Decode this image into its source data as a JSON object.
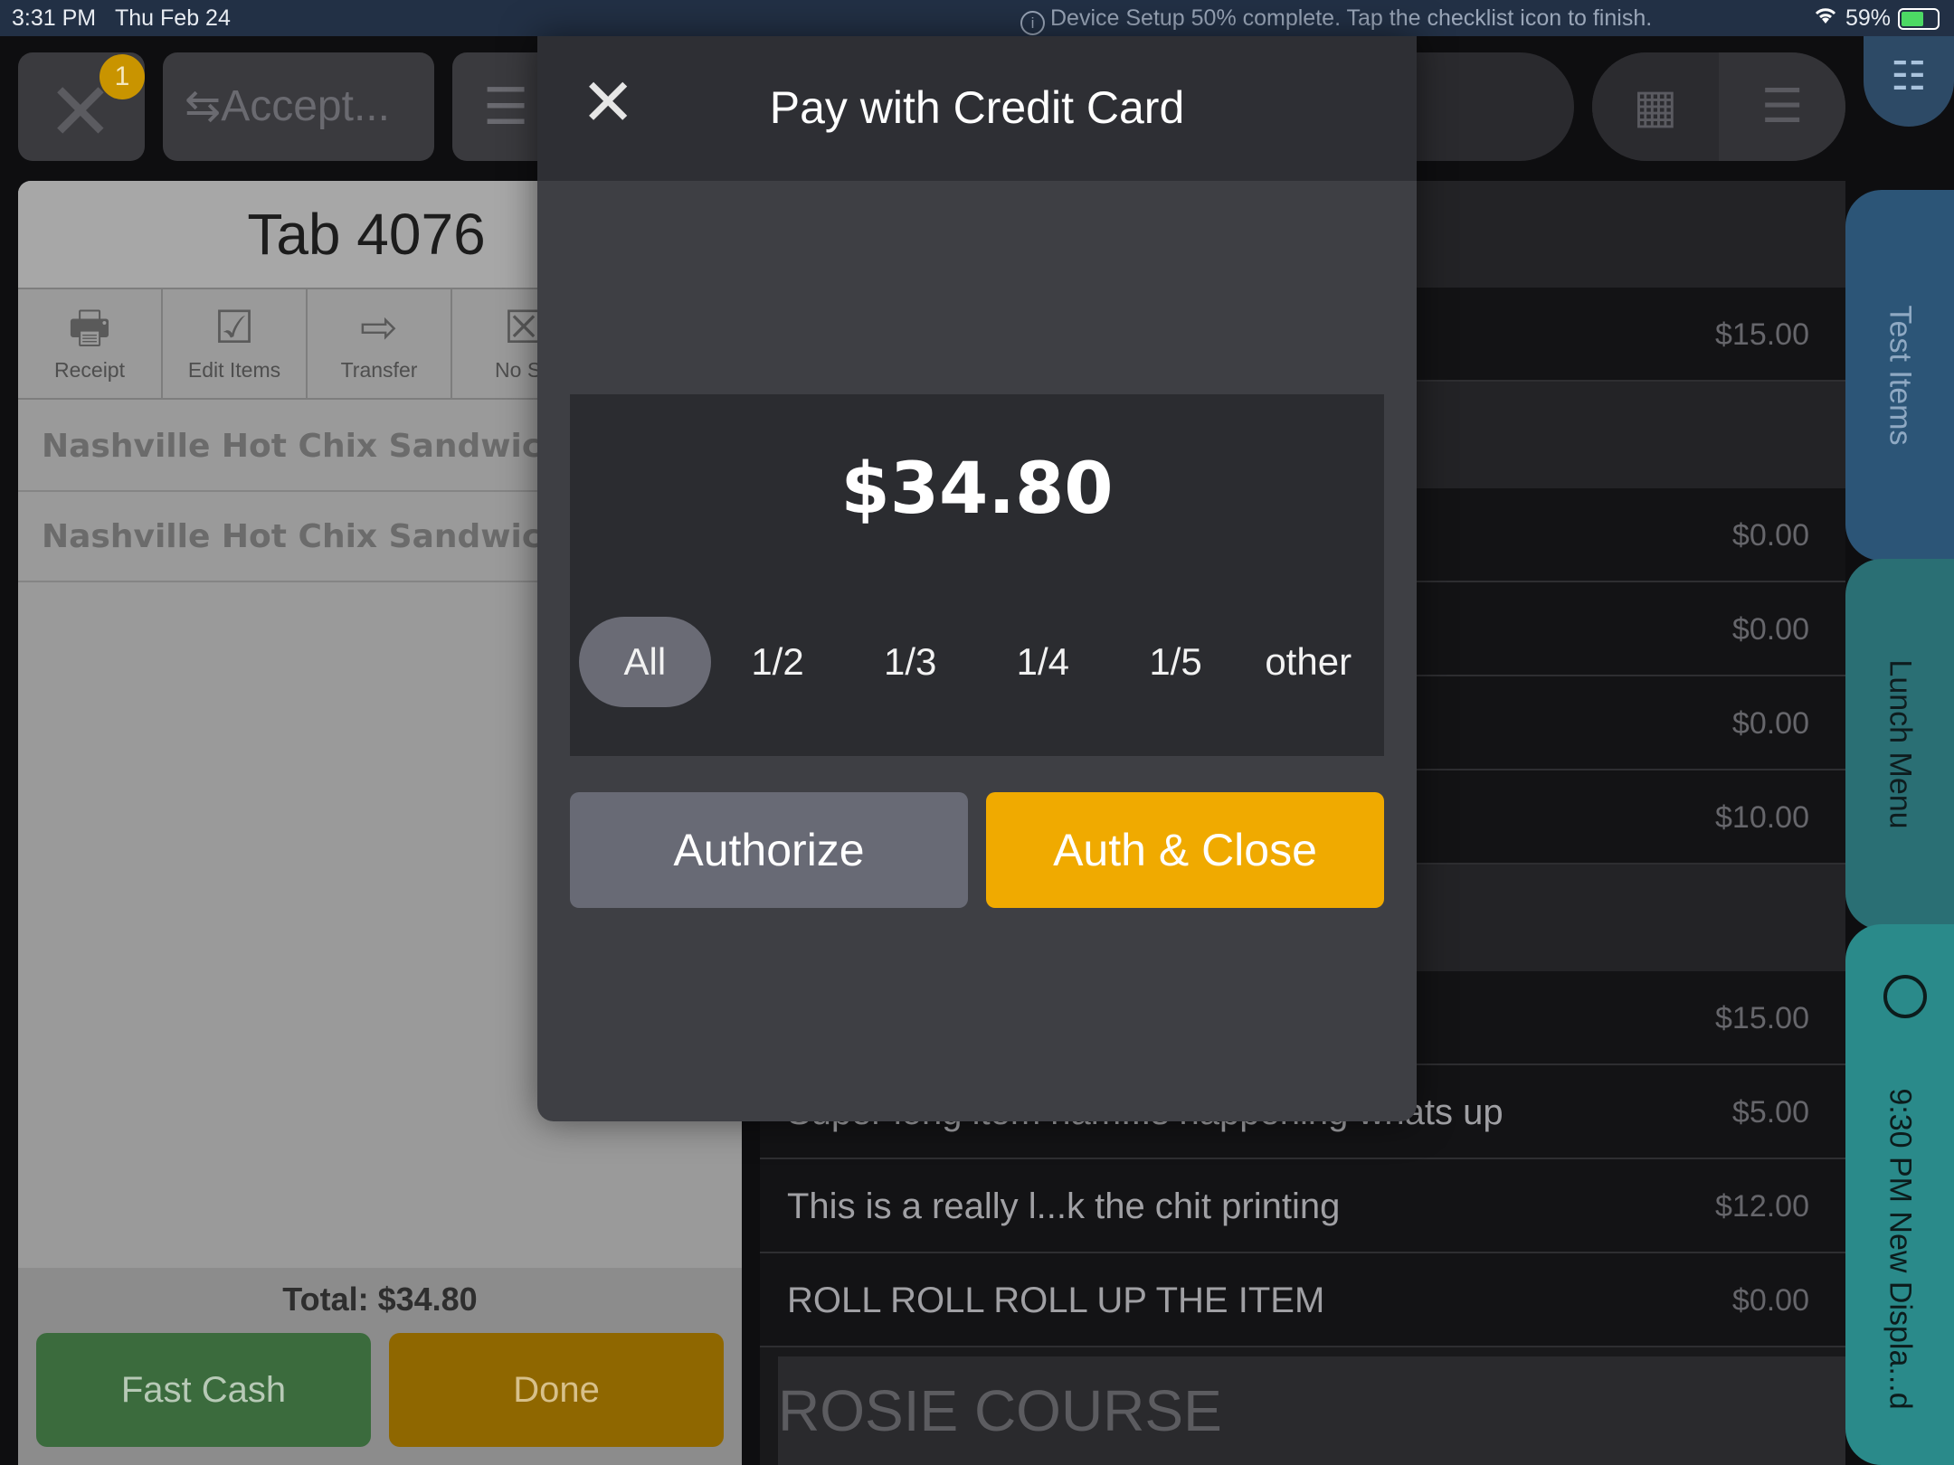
{
  "status_bar": {
    "time": "3:31 PM",
    "date": "Thu Feb 24",
    "notice": "Device Setup 50% complete. Tap the checklist icon to finish.",
    "battery": "59%"
  },
  "toolbar": {
    "badge_count": "1",
    "accept_label": "⇆Accept..."
  },
  "tab": {
    "title": "Tab 4076",
    "actions": [
      {
        "label": "Receipt",
        "icon": "receipt-icon"
      },
      {
        "label": "Edit Items",
        "icon": "edit-icon"
      },
      {
        "label": "Transfer",
        "icon": "arrow-right-icon"
      },
      {
        "label": "No Sa",
        "icon": "no-sale-icon"
      }
    ],
    "items": [
      {
        "name": "Nashville Hot Chix Sandwich"
      },
      {
        "name": "Nashville Hot Chix Sandwich"
      }
    ],
    "total": "Total: $34.80",
    "fast_cash_label": "Fast Cash",
    "done_label": "Done"
  },
  "menu_list": {
    "rows": [
      {
        "name": "",
        "price": "$15.00"
      },
      {
        "name": "",
        "price": "$0.00"
      },
      {
        "name": "",
        "price": "$0.00"
      },
      {
        "name": "",
        "price": "$0.00"
      },
      {
        "name": "",
        "price": "$10.00"
      },
      {
        "name": "",
        "price": "$15.00"
      },
      {
        "name": "Super long item nam...s happening whats up",
        "price": "$5.00"
      },
      {
        "name": "This is a really l...k the chit printing",
        "price": "$12.00"
      },
      {
        "name": "ROLL ROLL ROLL UP THE ITEM",
        "price": "$0.00"
      }
    ],
    "course": "ROSIE COURSE"
  },
  "side_tabs": [
    "Test Items",
    "Lunch Menu",
    "9:30 PM New Displa...d"
  ],
  "modal": {
    "title": "Pay with Credit Card",
    "amount": "$34.80",
    "splits": [
      "All",
      "1/2",
      "1/3",
      "1/4",
      "1/5",
      "other"
    ],
    "selected_split": "All",
    "authorize_label": "Authorize",
    "auth_close_label": "Auth & Close",
    "colors": {
      "accent": "#f0aa00",
      "secondary": "#686a75"
    }
  }
}
